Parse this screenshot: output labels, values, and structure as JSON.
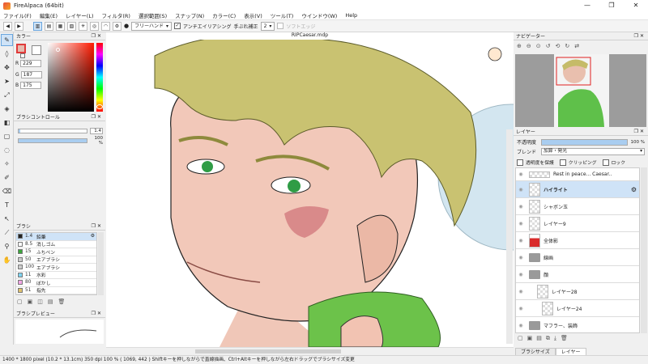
{
  "window": {
    "title": "FireAlpaca (64bit)",
    "controls": [
      "—",
      "❐",
      "✕"
    ]
  },
  "menu": [
    "ファイル(F)",
    "編集(E)",
    "レイヤー(L)",
    "フィルタ(R)",
    "選択範囲(S)",
    "スナップ(N)",
    "カラー(C)",
    "表示(V)",
    "ツール(T)",
    "ウインドウ(W)",
    "Help"
  ],
  "toolbar": {
    "brush_mode": "フリーハンド",
    "antialias_label": "アンチエイリアシング",
    "antialias_checked": "✓",
    "stabilizer_label": "手ぶれ補正",
    "stabilizer_value": "2",
    "soft_edge_label": "ソフトエッジ"
  },
  "color_panel": {
    "title": "カラー",
    "r_label": "R",
    "r_value": "229",
    "g_label": "G",
    "g_value": "187",
    "b_label": "B",
    "b_value": "175",
    "main_color": "#e5bbaf"
  },
  "brush_control": {
    "title": "ブラシコントロール",
    "size_value": "1.4",
    "opacity_value": "100 %",
    "opacity_fraction": 1.0
  },
  "brush_panel": {
    "title": "ブラシ",
    "items": [
      {
        "size": "1.4",
        "name": "鉛筆",
        "color": "#222222",
        "active": true
      },
      {
        "size": "8.5",
        "name": "消しゴム",
        "color": "#ffffff",
        "active": false
      },
      {
        "size": "15",
        "name": "ふちペン",
        "color": "#3ca53c",
        "active": false
      },
      {
        "size": "50",
        "name": "エアブラシ",
        "color": "#cccccc",
        "active": false
      },
      {
        "size": "100",
        "name": "エアブラシ",
        "color": "#cccccc",
        "active": false
      },
      {
        "size": "11",
        "name": "水彩",
        "color": "#7fd3f0",
        "active": false
      },
      {
        "size": "80",
        "name": "ぼかし",
        "color": "#f2a6e6",
        "active": false
      },
      {
        "size": "51",
        "name": "指先",
        "color": "#e0c26e",
        "active": false
      }
    ]
  },
  "brush_preview": {
    "title": "ブラシプレビュー"
  },
  "canvas": {
    "file_name": "RIPCaesar.mdp"
  },
  "navigator": {
    "title": "ナビゲーター"
  },
  "layers": {
    "title": "レイヤー",
    "opacity_label": "不透明度",
    "opacity_value": "100 %",
    "blend_label": "ブレンド",
    "blend_value": "加算・発光",
    "protect_alpha_label": "透明度を保護",
    "clipping_label": "クリッピング",
    "lock_label": "ロック",
    "items": [
      {
        "name": "Rest in peace... Caesar..",
        "type": "text",
        "active": false
      },
      {
        "name": "ハイライト",
        "type": "layer",
        "active": true
      },
      {
        "name": "シャボン玉",
        "type": "layer",
        "active": false
      },
      {
        "name": "レイヤー9",
        "type": "layer",
        "active": false
      },
      {
        "name": "全体影",
        "type": "red",
        "active": false
      },
      {
        "name": "線画",
        "type": "folder",
        "active": false
      },
      {
        "name": "顔",
        "type": "folder",
        "active": false
      },
      {
        "name": "レイヤー28",
        "type": "layer",
        "active": false
      },
      {
        "name": "レイヤー24",
        "type": "layer",
        "active": false
      },
      {
        "name": "マフラー、装飾",
        "type": "folder",
        "active": false
      }
    ],
    "tabs": [
      "ブラシサイズ",
      "レイヤー"
    ]
  },
  "status": {
    "text": "1400 * 1800 pixel  (10.2 * 13.1cm)  350 dpi  100 %  ( 1069, 442 )  Shiftキーを押しながらで直線描画、Ctrl+Altキーを押しながら左右ドラッグでブラシサイズ変更"
  }
}
